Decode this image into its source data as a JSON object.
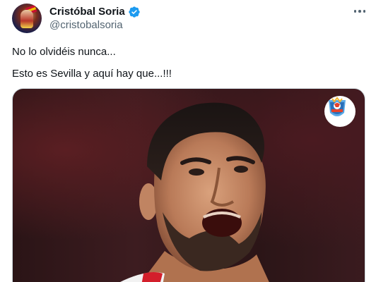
{
  "user": {
    "name": "Cristóbal Soria",
    "handle": "@cristobalsoria",
    "verified": true
  },
  "tweet": {
    "line1": "No lo olvidéis nunca...",
    "line2": "Esto es Sevilla y aquí hay que...!!!"
  },
  "icons": {
    "verified": "verified-badge-icon",
    "more": "more-options-icon",
    "media_logo": "sevilla-fan-logo"
  },
  "colors": {
    "verified_blue": "#1d9bf0",
    "secondary_text": "#536471",
    "primary_text": "#0f1419"
  }
}
